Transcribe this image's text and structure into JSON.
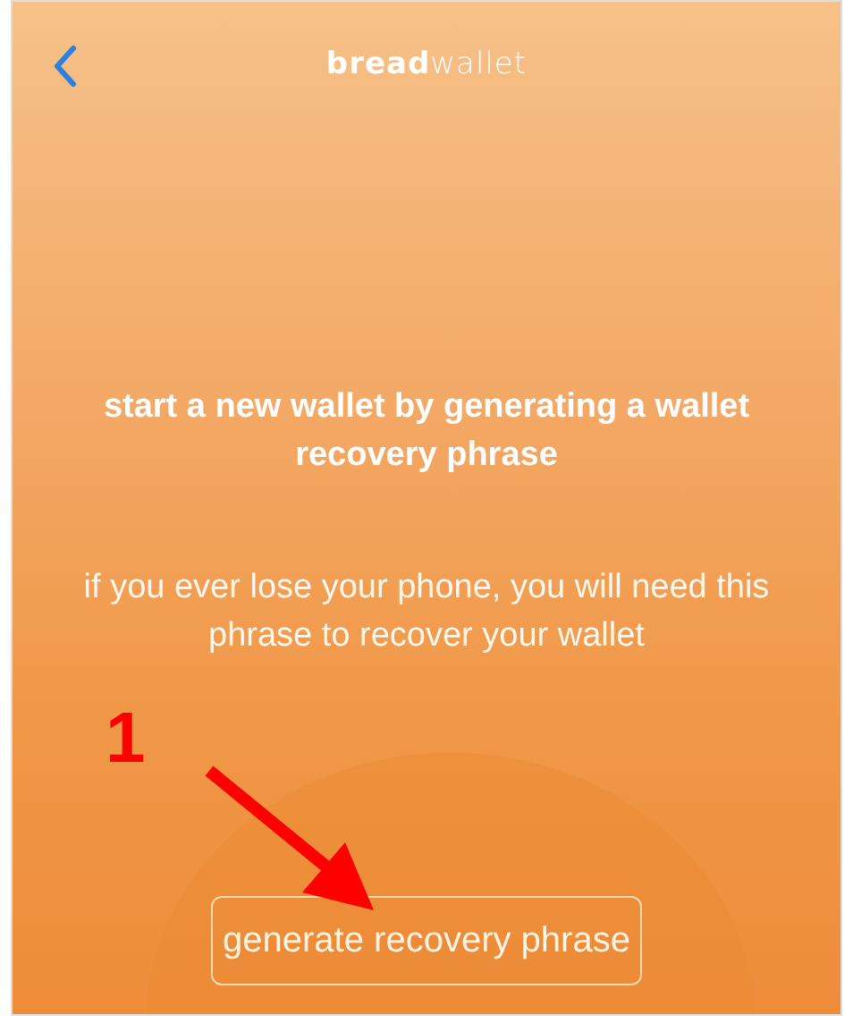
{
  "header": {
    "logo": "**bread**wallet"
  },
  "heading": "start a new wallet by generating a wallet recovery phrase",
  "description": "if you ever lose your phone, you will need this phrase to recover your wallet",
  "annotation": {
    "label": "1"
  },
  "button": {
    "label": "generate recovery phrase"
  }
}
